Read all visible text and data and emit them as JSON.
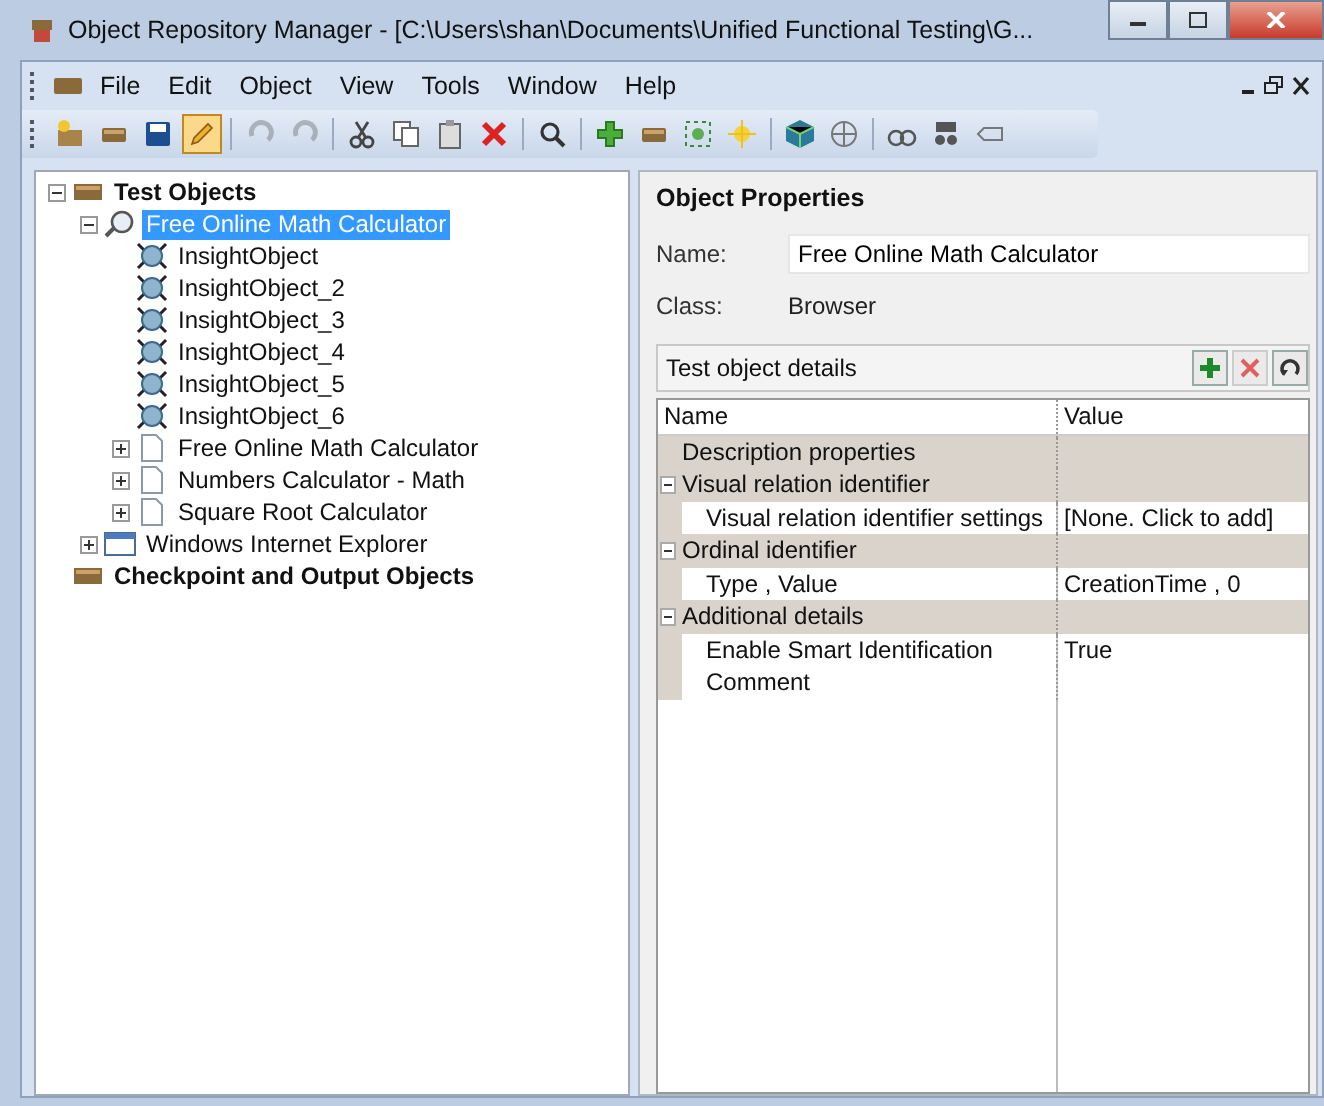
{
  "window": {
    "title": "Object Repository Manager - [C:\\Users\\shan\\Documents\\Unified Functional Testing\\G..."
  },
  "menu": [
    {
      "label": "File"
    },
    {
      "label": "Edit"
    },
    {
      "label": "Object"
    },
    {
      "label": "View"
    },
    {
      "label": "Tools"
    },
    {
      "label": "Window"
    },
    {
      "label": "Help"
    }
  ],
  "toolbar": [
    {
      "kind": "new",
      "selected": false,
      "disabled": false
    },
    {
      "kind": "open",
      "selected": false,
      "disabled": false
    },
    {
      "kind": "save",
      "selected": false,
      "disabled": false
    },
    {
      "kind": "edit",
      "selected": true,
      "disabled": false
    },
    {
      "kind": "sep"
    },
    {
      "kind": "undo",
      "selected": false,
      "disabled": true
    },
    {
      "kind": "redo",
      "selected": false,
      "disabled": true
    },
    {
      "kind": "sep"
    },
    {
      "kind": "cut",
      "selected": false,
      "disabled": false
    },
    {
      "kind": "copy",
      "selected": false,
      "disabled": false
    },
    {
      "kind": "paste",
      "selected": false,
      "disabled": false
    },
    {
      "kind": "delete",
      "selected": false,
      "disabled": false
    },
    {
      "kind": "sep"
    },
    {
      "kind": "find",
      "selected": false,
      "disabled": false
    },
    {
      "kind": "sep"
    },
    {
      "kind": "add",
      "selected": false,
      "disabled": false
    },
    {
      "kind": "repo",
      "selected": false,
      "disabled": false
    },
    {
      "kind": "capture",
      "selected": false,
      "disabled": false
    },
    {
      "kind": "star",
      "selected": false,
      "disabled": false
    },
    {
      "kind": "sep"
    },
    {
      "kind": "cube",
      "selected": false,
      "disabled": false
    },
    {
      "kind": "target",
      "selected": false,
      "disabled": false
    },
    {
      "kind": "sep"
    },
    {
      "kind": "highlight",
      "selected": false,
      "disabled": false
    },
    {
      "kind": "spy",
      "selected": false,
      "disabled": false
    },
    {
      "kind": "tag",
      "selected": false,
      "disabled": false
    }
  ],
  "tree": [
    {
      "label": "Test Objects",
      "kind": "repository",
      "selected": false,
      "expanded": true,
      "children": [
        {
          "label": "Free Online Math Calculator",
          "kind": "browser",
          "selected": true,
          "expanded": true,
          "children": [
            {
              "label": "InsightObject",
              "kind": "insight",
              "selected": false
            },
            {
              "label": "InsightObject_2",
              "kind": "insight",
              "selected": false
            },
            {
              "label": "InsightObject_3",
              "kind": "insight",
              "selected": false
            },
            {
              "label": "InsightObject_4",
              "kind": "insight",
              "selected": false
            },
            {
              "label": "InsightObject_5",
              "kind": "insight",
              "selected": false
            },
            {
              "label": "InsightObject_6",
              "kind": "insight",
              "selected": false
            },
            {
              "label": "Free Online Math Calculator",
              "kind": "page",
              "selected": false,
              "expanded": false
            },
            {
              "label": "Numbers Calculator - Math",
              "kind": "page",
              "selected": false,
              "expanded": false
            },
            {
              "label": "Square Root Calculator",
              "kind": "page",
              "selected": false,
              "expanded": false
            }
          ]
        },
        {
          "label": "Windows Internet Explorer",
          "kind": "window",
          "selected": false,
          "expanded": false
        }
      ]
    },
    {
      "label": "Checkpoint and Output Objects",
      "kind": "repository",
      "selected": false
    }
  ],
  "properties": {
    "title": "Object Properties",
    "name_label": "Name:",
    "name_value": "Free Online Math Calculator",
    "class_label": "Class:",
    "class_value": "Browser",
    "details_title": "Test object details",
    "columns": [
      "Name",
      "Value"
    ],
    "rows": [
      {
        "kind": "group",
        "name": "Description properties",
        "value": ""
      },
      {
        "kind": "group",
        "name": "Visual relation identifier",
        "value": "",
        "expanded": true
      },
      {
        "kind": "prop",
        "name": "Visual relation identifier settings",
        "value": "[None. Click to add]"
      },
      {
        "kind": "group",
        "name": "Ordinal identifier",
        "value": "",
        "expanded": true
      },
      {
        "kind": "prop",
        "name": "Type , Value",
        "value": "CreationTime , 0"
      },
      {
        "kind": "group",
        "name": "Additional details",
        "value": "",
        "expanded": true
      },
      {
        "kind": "prop",
        "name": "Enable Smart Identification",
        "value": "True"
      },
      {
        "kind": "prop",
        "name": "Comment",
        "value": ""
      }
    ]
  }
}
